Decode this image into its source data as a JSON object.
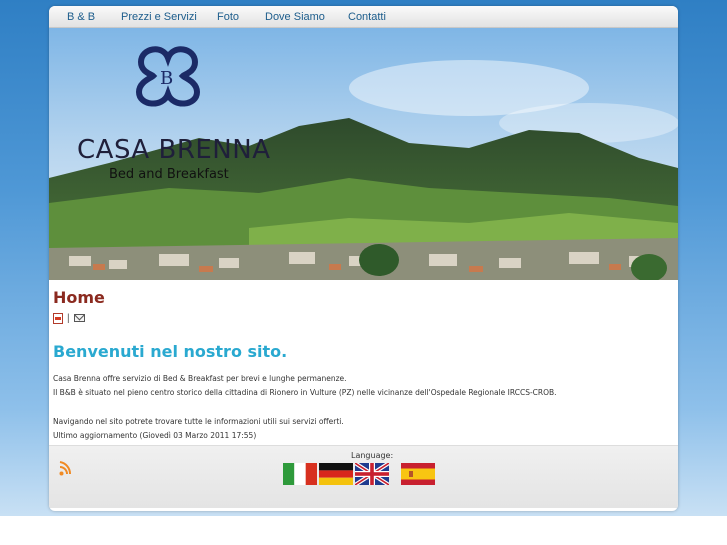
{
  "nav": {
    "items": [
      "B & B",
      "Prezzi e Servizi",
      "Foto",
      "Dove Siamo",
      "Contatti"
    ]
  },
  "header": {
    "logo_letter": "B",
    "brand_title": "CASA BRENNA",
    "brand_subtitle": "Bed and Breakfast"
  },
  "content": {
    "page_title": "Home",
    "icons_separator": "|",
    "welcome_heading": "Benvenuti nel nostro sito.",
    "paragraphs": [
      "Casa Brenna offre servizio di Bed & Breakfast per brevi e lunghe permanenze.",
      "Il B&B è situato nel pieno centro storico della cittadina di Rionero in Vulture (PZ) nelle vicinanze dell'Ospedale Regionale IRCCS-CROB.",
      "Navigando nel sito potrete trovare tutte le informazioni utili sui servizi offerti.",
      "Ultimo aggiornamento (Giovedì 03 Marzo 2011 17:55)"
    ]
  },
  "footer": {
    "language_label": "Language:",
    "flags": [
      "italian-flag",
      "german-flag",
      "english-flag",
      "spanish-flag"
    ]
  },
  "icons": {
    "pdf": "pdf-icon",
    "email": "email-icon",
    "rss": "rss-icon"
  },
  "colors": {
    "page_title": "#8b2a1f",
    "welcome": "#2aa9d0",
    "nav_link": "#1d5d8c",
    "logo": "#1b2a66",
    "rss": "#f08a24"
  }
}
